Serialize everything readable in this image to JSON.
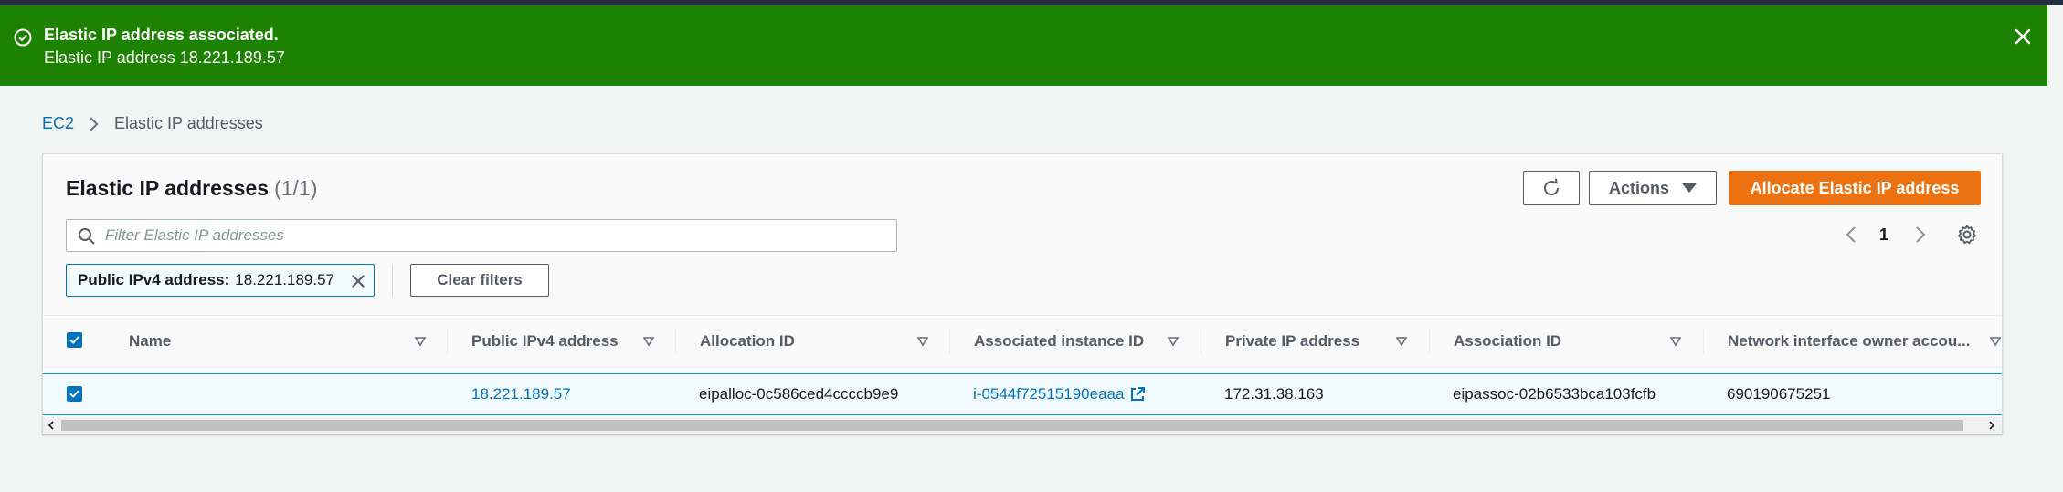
{
  "flash": {
    "title": "Elastic IP address associated.",
    "message": "Elastic IP address 18.221.189.57",
    "color": "#1d8102"
  },
  "breadcrumb": {
    "root": "EC2",
    "current": "Elastic IP addresses"
  },
  "panel": {
    "title": "Elastic IP addresses",
    "count": "(1/1)",
    "buttons": {
      "actions": "Actions",
      "allocate": "Allocate Elastic IP address",
      "clear_filters": "Clear filters"
    },
    "search": {
      "placeholder": "Filter Elastic IP addresses",
      "value": ""
    },
    "filter_token": {
      "key": "Public IPv4 address:",
      "value": "18.221.189.57"
    },
    "pagination": {
      "page": "1"
    }
  },
  "table": {
    "columns": [
      "Name",
      "Public IPv4 address",
      "Allocation ID",
      "Associated instance ID",
      "Private IP address",
      "Association ID",
      "Network interface owner accou..."
    ],
    "rows": [
      {
        "selected": true,
        "name": "",
        "public_ip": "18.221.189.57",
        "allocation_id": "eipalloc-0c586ced4ccccb9e9",
        "instance_id": "i-0544f72515190eaaa",
        "private_ip": "172.31.38.163",
        "association_id": "eipassoc-02b6533bca103fcfb",
        "owner_account": "690190675251"
      }
    ]
  },
  "colors": {
    "accent": "#ec7211",
    "link": "#0073bb",
    "header_bar": "#232f3e"
  },
  "icons": [
    "check-circle-icon",
    "close-icon",
    "chevron-right-icon",
    "refresh-icon",
    "caret-down-icon",
    "search-icon",
    "chevron-left-icon",
    "gear-icon",
    "sort-icon",
    "external-link-icon",
    "checkbox-icon"
  ]
}
